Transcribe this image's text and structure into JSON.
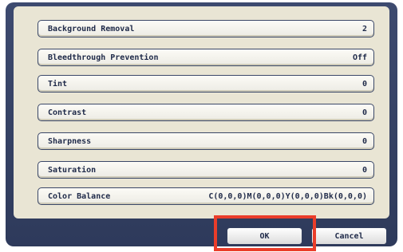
{
  "settings": [
    {
      "label": "Background Removal",
      "value": "2"
    },
    {
      "label": "Bleedthrough Prevention",
      "value": "Off"
    },
    {
      "label": "Tint",
      "value": "0"
    },
    {
      "label": "Contrast",
      "value": "0"
    },
    {
      "label": "Sharpness",
      "value": "0"
    },
    {
      "label": "Saturation",
      "value": "0"
    },
    {
      "label": "Color Balance",
      "value": "C(0,0,0)M(0,0,0)Y(0,0,0)Bk(0,0,0)"
    }
  ],
  "footer": {
    "ok_label": "OK",
    "cancel_label": "Cancel"
  },
  "colors": {
    "panel": "#2e3a5b",
    "content_bg": "#e9e5d4",
    "highlight": "#ea3d2a"
  }
}
